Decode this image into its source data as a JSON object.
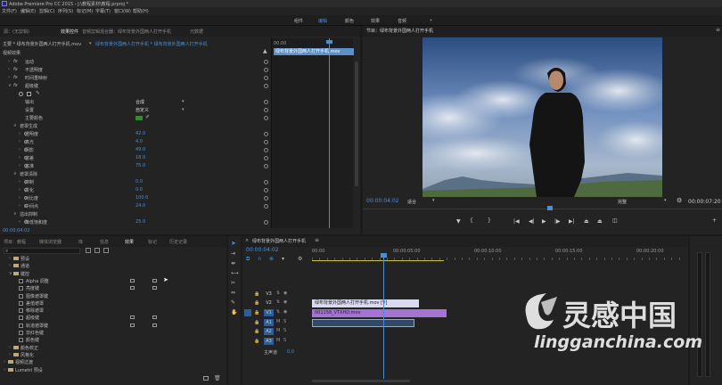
{
  "app": {
    "title": "Adobe Premiere Pro CC 2015 - J:\\教程素材\\教程.prproj *",
    "menu": [
      "文件(F)",
      "编辑(E)",
      "剪辑(C)",
      "序列(S)",
      "标记(M)",
      "字幕(T)",
      "窗口(W)",
      "帮助(H)"
    ],
    "workspaces": [
      "组件",
      "编辑",
      "颜色",
      "效果",
      "音频",
      "»"
    ],
    "active_workspace": "编辑"
  },
  "effect_controls": {
    "tabs": [
      "源：(无剪辑)",
      "效果控件",
      "音频剪辑混合器：绿布背景外国两人打开手机",
      "元数据"
    ],
    "active_tab": "效果控件",
    "clip_header": "主要 * 绿布背景外国两人打开手机.mov",
    "clip_path": "绿布背景外国两人打开手机 * 绿布背景外国两人打开手机",
    "section": "视频效果",
    "mini_tc": "00:00",
    "mini_clip": "绿布背景外国两人打开手机.mov",
    "rows": [
      {
        "label": "运动",
        "indent": 1,
        "fx": true,
        "expand": "›"
      },
      {
        "label": "不透明度",
        "indent": 1,
        "fx": true,
        "expand": "›"
      },
      {
        "label": "时间重映射",
        "indent": 1,
        "fx": true,
        "expand": "›"
      },
      {
        "label": "超级键",
        "indent": 1,
        "fx": true,
        "expand": "∨"
      },
      {
        "label": "",
        "indent": 2,
        "icons": true
      },
      {
        "label": "输出",
        "indent": 3,
        "value": "合成"
      },
      {
        "label": "设置",
        "indent": 3,
        "value": "自定义"
      },
      {
        "label": "主要颜色",
        "indent": 3,
        "value": "swatch"
      },
      {
        "label": "遮罩生成",
        "indent": 2,
        "expand": "∨"
      },
      {
        "label": "透明度",
        "indent": 3,
        "value": "42.0",
        "expand": "›"
      },
      {
        "label": "高光",
        "indent": 3,
        "value": "4.0",
        "expand": "›"
      },
      {
        "label": "阴影",
        "indent": 3,
        "value": "49.0",
        "expand": "›"
      },
      {
        "label": "容差",
        "indent": 3,
        "value": "18.0",
        "expand": "›"
      },
      {
        "label": "基准",
        "indent": 3,
        "value": "75.0",
        "expand": "›"
      },
      {
        "label": "遮罩清除",
        "indent": 2,
        "expand": "∨"
      },
      {
        "label": "抑制",
        "indent": 3,
        "value": "0.0",
        "expand": "›"
      },
      {
        "label": "柔化",
        "indent": 3,
        "value": "0.0",
        "expand": "›"
      },
      {
        "label": "对比度",
        "indent": 3,
        "value": "100.0",
        "expand": "›"
      },
      {
        "label": "中间点",
        "indent": 3,
        "value": "24.0",
        "expand": "›"
      },
      {
        "label": "溢出抑制",
        "indent": 2,
        "expand": "∨"
      },
      {
        "label": "降低饱和度",
        "indent": 3,
        "value": "25.0",
        "expand": "›"
      }
    ],
    "footer_tc": "00:00:04:02"
  },
  "program_monitor": {
    "title": "节目：绿布背景外国两人打开手机",
    "timecode": "00:00:04:02",
    "fit": "适合",
    "quality": "完整",
    "duration": "00:00:07:20"
  },
  "project": {
    "tabs": [
      "项目：教程",
      "媒体浏览器",
      "库",
      "信息",
      "效果",
      "标记",
      "历史记录"
    ],
    "active_tab": "效果",
    "tree": [
      {
        "label": "预设",
        "indent": 1,
        "type": "folder",
        "expand": "›"
      },
      {
        "label": "通道",
        "indent": 1,
        "type": "folder",
        "expand": "›"
      },
      {
        "label": "键控",
        "indent": 1,
        "type": "folder",
        "expand": "∨"
      },
      {
        "label": "Alpha 调整",
        "indent": 2,
        "type": "fx",
        "badges": true
      },
      {
        "label": "亮度键",
        "indent": 2,
        "type": "fx",
        "badges": true
      },
      {
        "label": "图像遮罩键",
        "indent": 2,
        "type": "fx"
      },
      {
        "label": "差值遮罩",
        "indent": 2,
        "type": "fx"
      },
      {
        "label": "移除遮罩",
        "indent": 2,
        "type": "fx"
      },
      {
        "label": "超级键",
        "indent": 2,
        "type": "fx",
        "badges": true
      },
      {
        "label": "轨道遮罩键",
        "indent": 2,
        "type": "fx",
        "badges": true
      },
      {
        "label": "非红色键",
        "indent": 2,
        "type": "fx"
      },
      {
        "label": "颜色键",
        "indent": 2,
        "type": "fx"
      },
      {
        "label": "颜色校正",
        "indent": 1,
        "type": "folder",
        "expand": "›"
      },
      {
        "label": "风格化",
        "indent": 1,
        "type": "folder",
        "expand": "›"
      },
      {
        "label": "视频过渡",
        "indent": 0,
        "type": "folder",
        "expand": "›"
      },
      {
        "label": "Lumetri 预设",
        "indent": 0,
        "type": "folder",
        "expand": "›"
      }
    ]
  },
  "timeline": {
    "tab": "绿布背景外国两人打开手机",
    "timecode": "00:00:04:02",
    "ruler": [
      "00:00",
      "00:00:05:00",
      "00:00:10:00",
      "00:00:15:00",
      "00:00:20:00"
    ],
    "tracks": [
      {
        "id": "V3",
        "kind": "video"
      },
      {
        "id": "V2",
        "kind": "video"
      },
      {
        "id": "V1",
        "kind": "video"
      },
      {
        "id": "A1",
        "kind": "audio"
      },
      {
        "id": "A2",
        "kind": "audio"
      },
      {
        "id": "A3",
        "kind": "audio"
      }
    ],
    "master_label": "主声道",
    "master_value": "0.0",
    "clips": [
      {
        "track": "V2",
        "label": "绿布背景外国两人打开手机.mov [V]",
        "color": "#d9d9f0"
      },
      {
        "track": "V1",
        "label": "001158_VTXHD.mov",
        "color": "#a473d4"
      },
      {
        "track": "A1",
        "label": "",
        "color": "#2f4a66"
      }
    ]
  },
  "watermark": {
    "brand": "灵感中国",
    "site": "lingganchina.com"
  },
  "colors": {
    "accent": "#4a8fd6",
    "clip_purple": "#a473d4",
    "sky": "#5b7fb5",
    "yellow_work_area": "#c9c23c"
  }
}
